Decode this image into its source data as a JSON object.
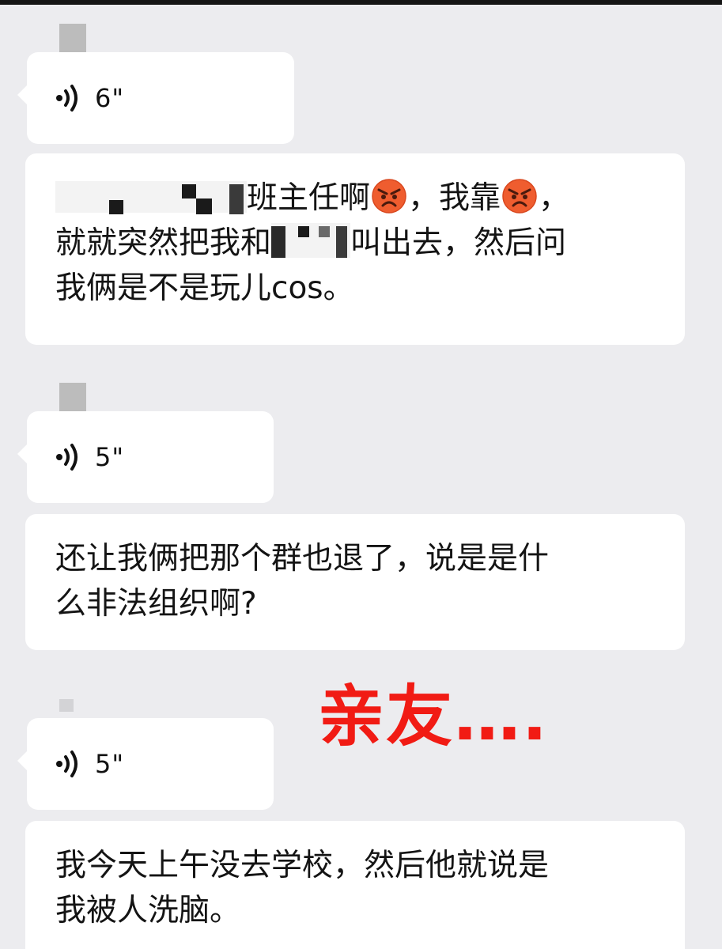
{
  "messages": [
    {
      "type": "voice",
      "duration": "6\""
    },
    {
      "type": "text",
      "segments": {
        "part1": "班主任啊",
        "part2": "，我靠",
        "part3": "，",
        "line2a": "就就突然把我和",
        "line2b": "叫出去，然后问",
        "line3": "我俩是不是玩儿cos。"
      }
    },
    {
      "type": "voice",
      "duration": "5\""
    },
    {
      "type": "text",
      "lines": [
        "还让我俩把那个群也退了，说是是什",
        "么非法组织啊?"
      ]
    },
    {
      "type": "voice",
      "duration": "5\""
    },
    {
      "type": "text",
      "lines": [
        "我今天上午没去学校，然后他就说是",
        "我被人洗脑。"
      ]
    }
  ],
  "overlay": {
    "caption": "亲友…."
  },
  "icons": {
    "voice": "voice-wave-icon",
    "emoji": "pouting-angry-face-icon"
  },
  "colors": {
    "background": "#ececef",
    "bubble": "#ffffff",
    "caption": "#f11b14"
  }
}
